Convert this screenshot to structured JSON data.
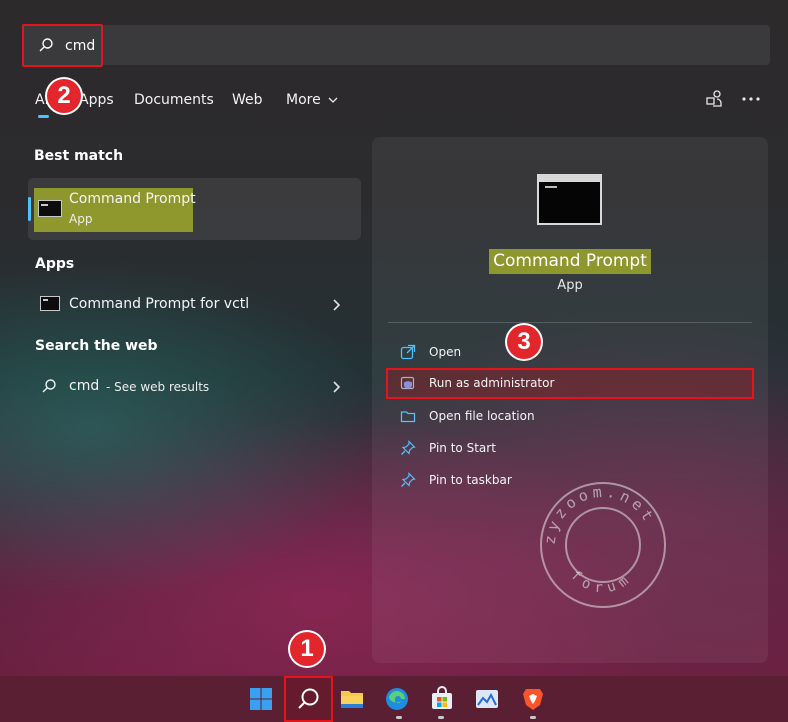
{
  "search": {
    "query": "cmd"
  },
  "tabs": [
    {
      "label": "All"
    },
    {
      "label": "Apps"
    },
    {
      "label": "Documents"
    },
    {
      "label": "Web"
    },
    {
      "label": "More"
    }
  ],
  "sections": {
    "best_match": "Best match",
    "apps": "Apps",
    "search_web": "Search the web"
  },
  "best_match": {
    "title": "Command Prompt",
    "subtitle": "App"
  },
  "apps_items": [
    {
      "label": "Command Prompt for vctl"
    }
  ],
  "web_items": [
    {
      "query": "cmd",
      "suffix": "- See web results"
    }
  ],
  "detail": {
    "title": "Command Prompt",
    "type": "App",
    "actions": [
      {
        "label": "Open",
        "icon": "open-external-icon"
      },
      {
        "label": "Run as administrator",
        "icon": "shield-icon"
      },
      {
        "label": "Open file location",
        "icon": "folder-icon"
      },
      {
        "label": "Pin to Start",
        "icon": "pin-icon"
      },
      {
        "label": "Pin to taskbar",
        "icon": "pin-icon"
      }
    ]
  },
  "annotations": {
    "step1": "1",
    "step2": "2",
    "step3": "3"
  },
  "watermark": {
    "text": "zyzoom.net",
    "subtext": "forum"
  },
  "taskbar": [
    {
      "name": "start",
      "icon": "windows-icon"
    },
    {
      "name": "search",
      "icon": "search-icon"
    },
    {
      "name": "file-explorer",
      "icon": "folder-icon"
    },
    {
      "name": "edge",
      "icon": "edge-icon"
    },
    {
      "name": "store",
      "icon": "store-icon"
    },
    {
      "name": "photos",
      "icon": "photos-icon"
    },
    {
      "name": "brave",
      "icon": "brave-icon"
    }
  ],
  "colors": {
    "accent": "#4cc2ff",
    "highlight_red": "#e3141c",
    "highlight_yellow": "#9ea82a"
  }
}
